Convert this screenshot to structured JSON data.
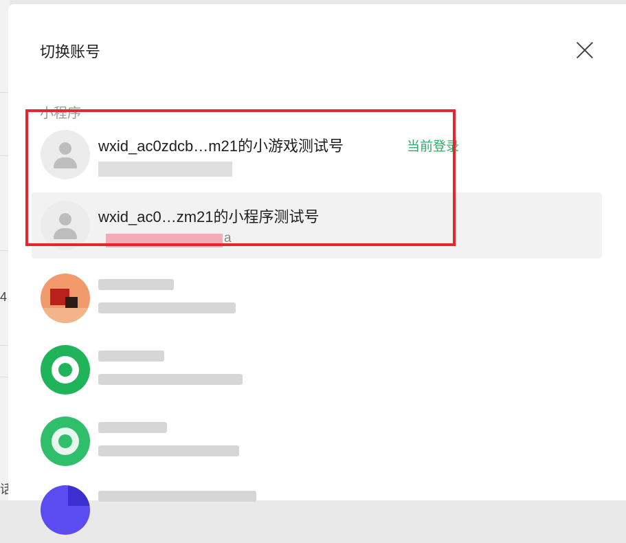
{
  "dialog": {
    "title": "切换账号",
    "section_label": "小程序",
    "close_icon": "close-icon"
  },
  "accounts": [
    {
      "name": "wxid_ac0zdcb…m21的小游戏测试号",
      "status": "当前登录",
      "subtitle": "",
      "avatar": "default-user-avatar",
      "highlighted": true
    },
    {
      "name": "wxid_ac0…zm21的小程序测试号",
      "status": "",
      "subtitle": "a",
      "avatar": "default-user-avatar",
      "highlighted": true,
      "hover": true
    },
    {
      "name": "",
      "subtitle": "",
      "avatar": "pixelated-orange-avatar"
    },
    {
      "name": "",
      "subtitle": "",
      "avatar": "pixelated-green-avatar"
    },
    {
      "name": "",
      "subtitle": "",
      "avatar": "pixelated-green-avatar"
    },
    {
      "name": "",
      "subtitle": "",
      "avatar": "pixelated-purple-avatar"
    }
  ],
  "background": {
    "glyph_1": "4",
    "glyph_2": "话"
  },
  "colors": {
    "status_green": "#2aae67",
    "highlight_red": "#e8242d",
    "hover_bg": "#f2f2f2"
  }
}
